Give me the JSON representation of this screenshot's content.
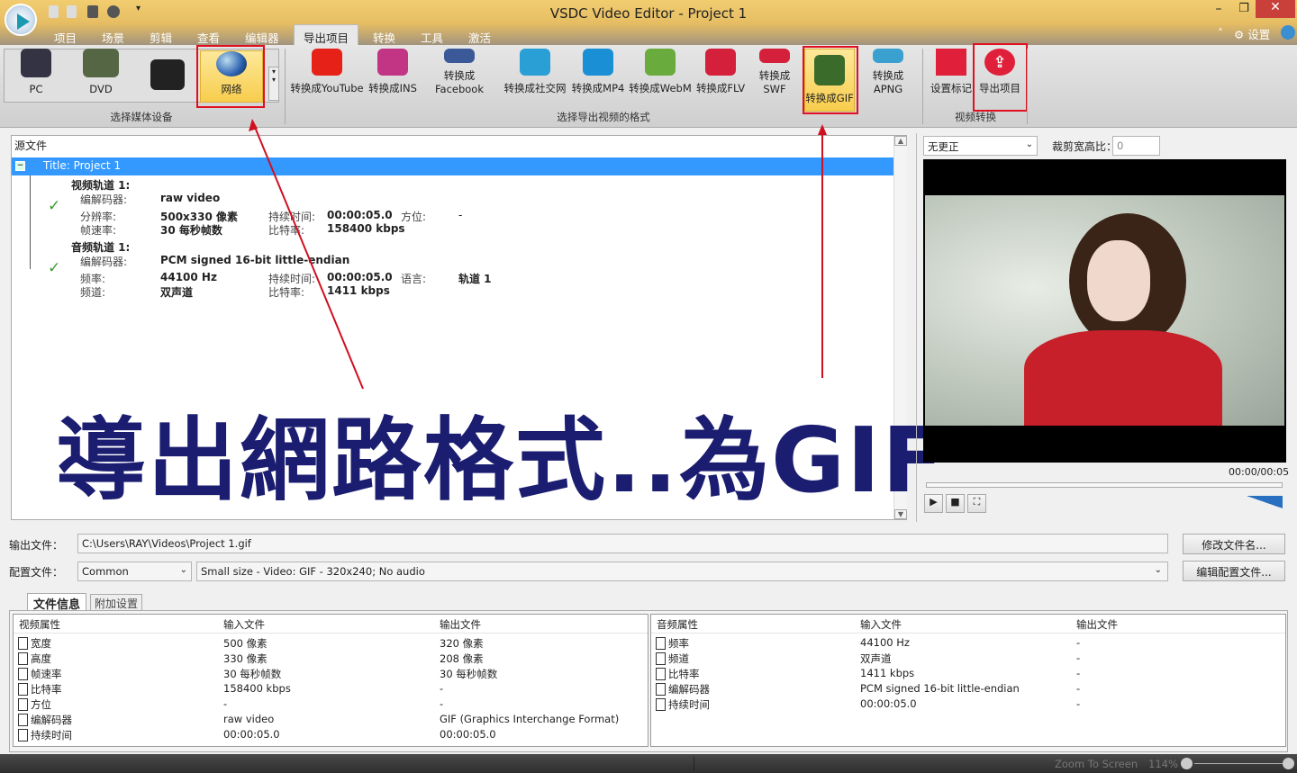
{
  "window": {
    "title": "VSDC Video Editor - Project 1"
  },
  "menu": [
    "项目",
    "场景",
    "剪辑",
    "查看",
    "编辑器",
    "导出项目",
    "转换",
    "工具",
    "激活"
  ],
  "settings_label": "设置",
  "ribbon": {
    "devices": [
      {
        "label": "PC"
      },
      {
        "label": "DVD"
      },
      {
        "label": ""
      },
      {
        "label": "网络"
      }
    ],
    "devices_group": "选择媒体设备",
    "formats": [
      {
        "label": "转换成YouTube",
        "icon": "youtube-icon",
        "color": "#e62117"
      },
      {
        "label": "转换成INS",
        "icon": "instagram-icon",
        "color": "#c13584"
      },
      {
        "label": "转换成Facebook",
        "icon": "facebook-icon",
        "color": "#3b5998"
      },
      {
        "label": "转换成社交网",
        "icon": "social-icon",
        "color": "#2a9fd6"
      },
      {
        "label": "转换成MP4",
        "icon": "quicktime-icon",
        "color": "#1a8fd6"
      },
      {
        "label": "转换成WebM",
        "icon": "webm-icon",
        "color": "#6aab3e"
      },
      {
        "label": "转换成FLV",
        "icon": "flv-icon",
        "color": "#d4203a"
      },
      {
        "label": "转换成SWF",
        "icon": "flash-icon",
        "color": "#d4203a"
      },
      {
        "label": "转换成GIF",
        "icon": "gif-brush-icon",
        "color": "#3a6b2a"
      },
      {
        "label": "转换成APNG",
        "icon": "apng-icon",
        "color": "#3aa0d0"
      }
    ],
    "formats_group": "选择导出视频的格式",
    "actions": [
      {
        "label": "设置标记"
      },
      {
        "label": "导出项目"
      }
    ],
    "actions_group": "视频转换"
  },
  "source": {
    "header": "源文件",
    "title_row": "Title: Project 1",
    "video_track": "视频轨道 1:",
    "audio_track": "音频轨道 1:",
    "video": {
      "codec_l": "编解码器:",
      "codec": "raw video",
      "res_l": "分辨率:",
      "res": "500x330 像素",
      "fps_l": "帧速率:",
      "fps": "30 每秒帧数",
      "dur_l": "持续时间:",
      "dur": "00:00:05.0",
      "br_l": "比特率:",
      "br": "158400 kbps",
      "orient_l": "方位:",
      "orient": "-"
    },
    "audio": {
      "codec_l": "编解码器:",
      "codec": "PCM signed 16-bit little-endian",
      "freq_l": "频率:",
      "freq": "44100 Hz",
      "ch_l": "频道:",
      "ch": "双声道",
      "dur_l": "持续时间:",
      "dur": "00:00:05.0",
      "br_l": "比特率:",
      "br": "1411 kbps",
      "lang_l": "语言:",
      "lang": "轨道 1"
    }
  },
  "overlay_text": "導出網路格式..為GIF",
  "preview": {
    "rotate": "无更正",
    "crop_label": "裁剪宽高比：",
    "crop_value": "0",
    "time": "00:00/00:05"
  },
  "output": {
    "file_label": "输出文件：",
    "file_value": "C:\\Users\\RAY\\Videos\\Project 1.gif",
    "rename": "修改文件名...",
    "profile_label": "配置文件：",
    "profile_group": "Common",
    "profile_value": "Small size - Video: GIF - 320x240; No audio",
    "edit_profile": "编辑配置文件..."
  },
  "tabs": [
    "文件信息",
    "附加设置"
  ],
  "video_table": {
    "headers": [
      "视频属性",
      "输入文件",
      "输出文件"
    ],
    "rows": [
      [
        "宽度",
        "500 像素",
        "320 像素"
      ],
      [
        "高度",
        "330 像素",
        "208 像素"
      ],
      [
        "帧速率",
        "30 每秒帧数",
        "30 每秒帧数"
      ],
      [
        "比特率",
        "158400 kbps",
        "-"
      ],
      [
        "方位",
        "-",
        "-"
      ],
      [
        "编解码器",
        "raw video",
        "GIF (Graphics Interchange Format)"
      ],
      [
        "持续时间",
        "00:00:05.0",
        "00:00:05.0"
      ]
    ]
  },
  "audio_table": {
    "headers": [
      "音频属性",
      "输入文件",
      "输出文件"
    ],
    "rows": [
      [
        "频率",
        "44100 Hz",
        "-"
      ],
      [
        "频道",
        "双声道",
        "-"
      ],
      [
        "比特率",
        "1411 kbps",
        "-"
      ],
      [
        "编解码器",
        "PCM signed 16-bit little-endian",
        "-"
      ],
      [
        "持续时间",
        "00:00:05.0",
        "-"
      ]
    ]
  },
  "status": {
    "zoom_label": "Zoom To Screen",
    "zoom_value": "114%"
  }
}
